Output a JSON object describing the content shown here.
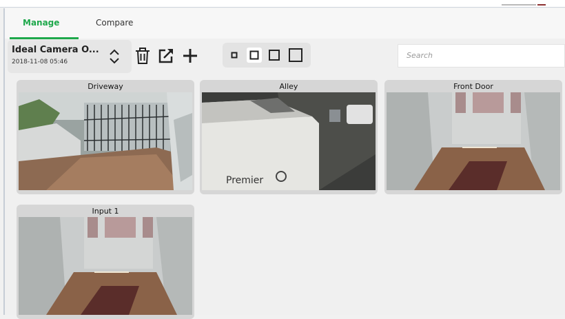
{
  "tabs": [
    {
      "label": "Manage",
      "active": true
    },
    {
      "label": "Compare",
      "active": false
    }
  ],
  "camera_selector": {
    "name": "Ideal Camera O...",
    "timestamp": "2018-11-08 05:46"
  },
  "toolbar_icons": [
    "updown-chevron-icon",
    "trash-icon",
    "external-link-icon",
    "plus-icon"
  ],
  "tile_sizes": {
    "options": 4,
    "selected_index": 1
  },
  "search": {
    "placeholder": "Search",
    "value": ""
  },
  "cameras": [
    {
      "label": "Driveway"
    },
    {
      "label": "Alley"
    },
    {
      "label": "Front Door"
    },
    {
      "label": "Input 1"
    }
  ],
  "colors": {
    "accent": "#1ea84b",
    "tile_bg": "#d6d6d6"
  }
}
